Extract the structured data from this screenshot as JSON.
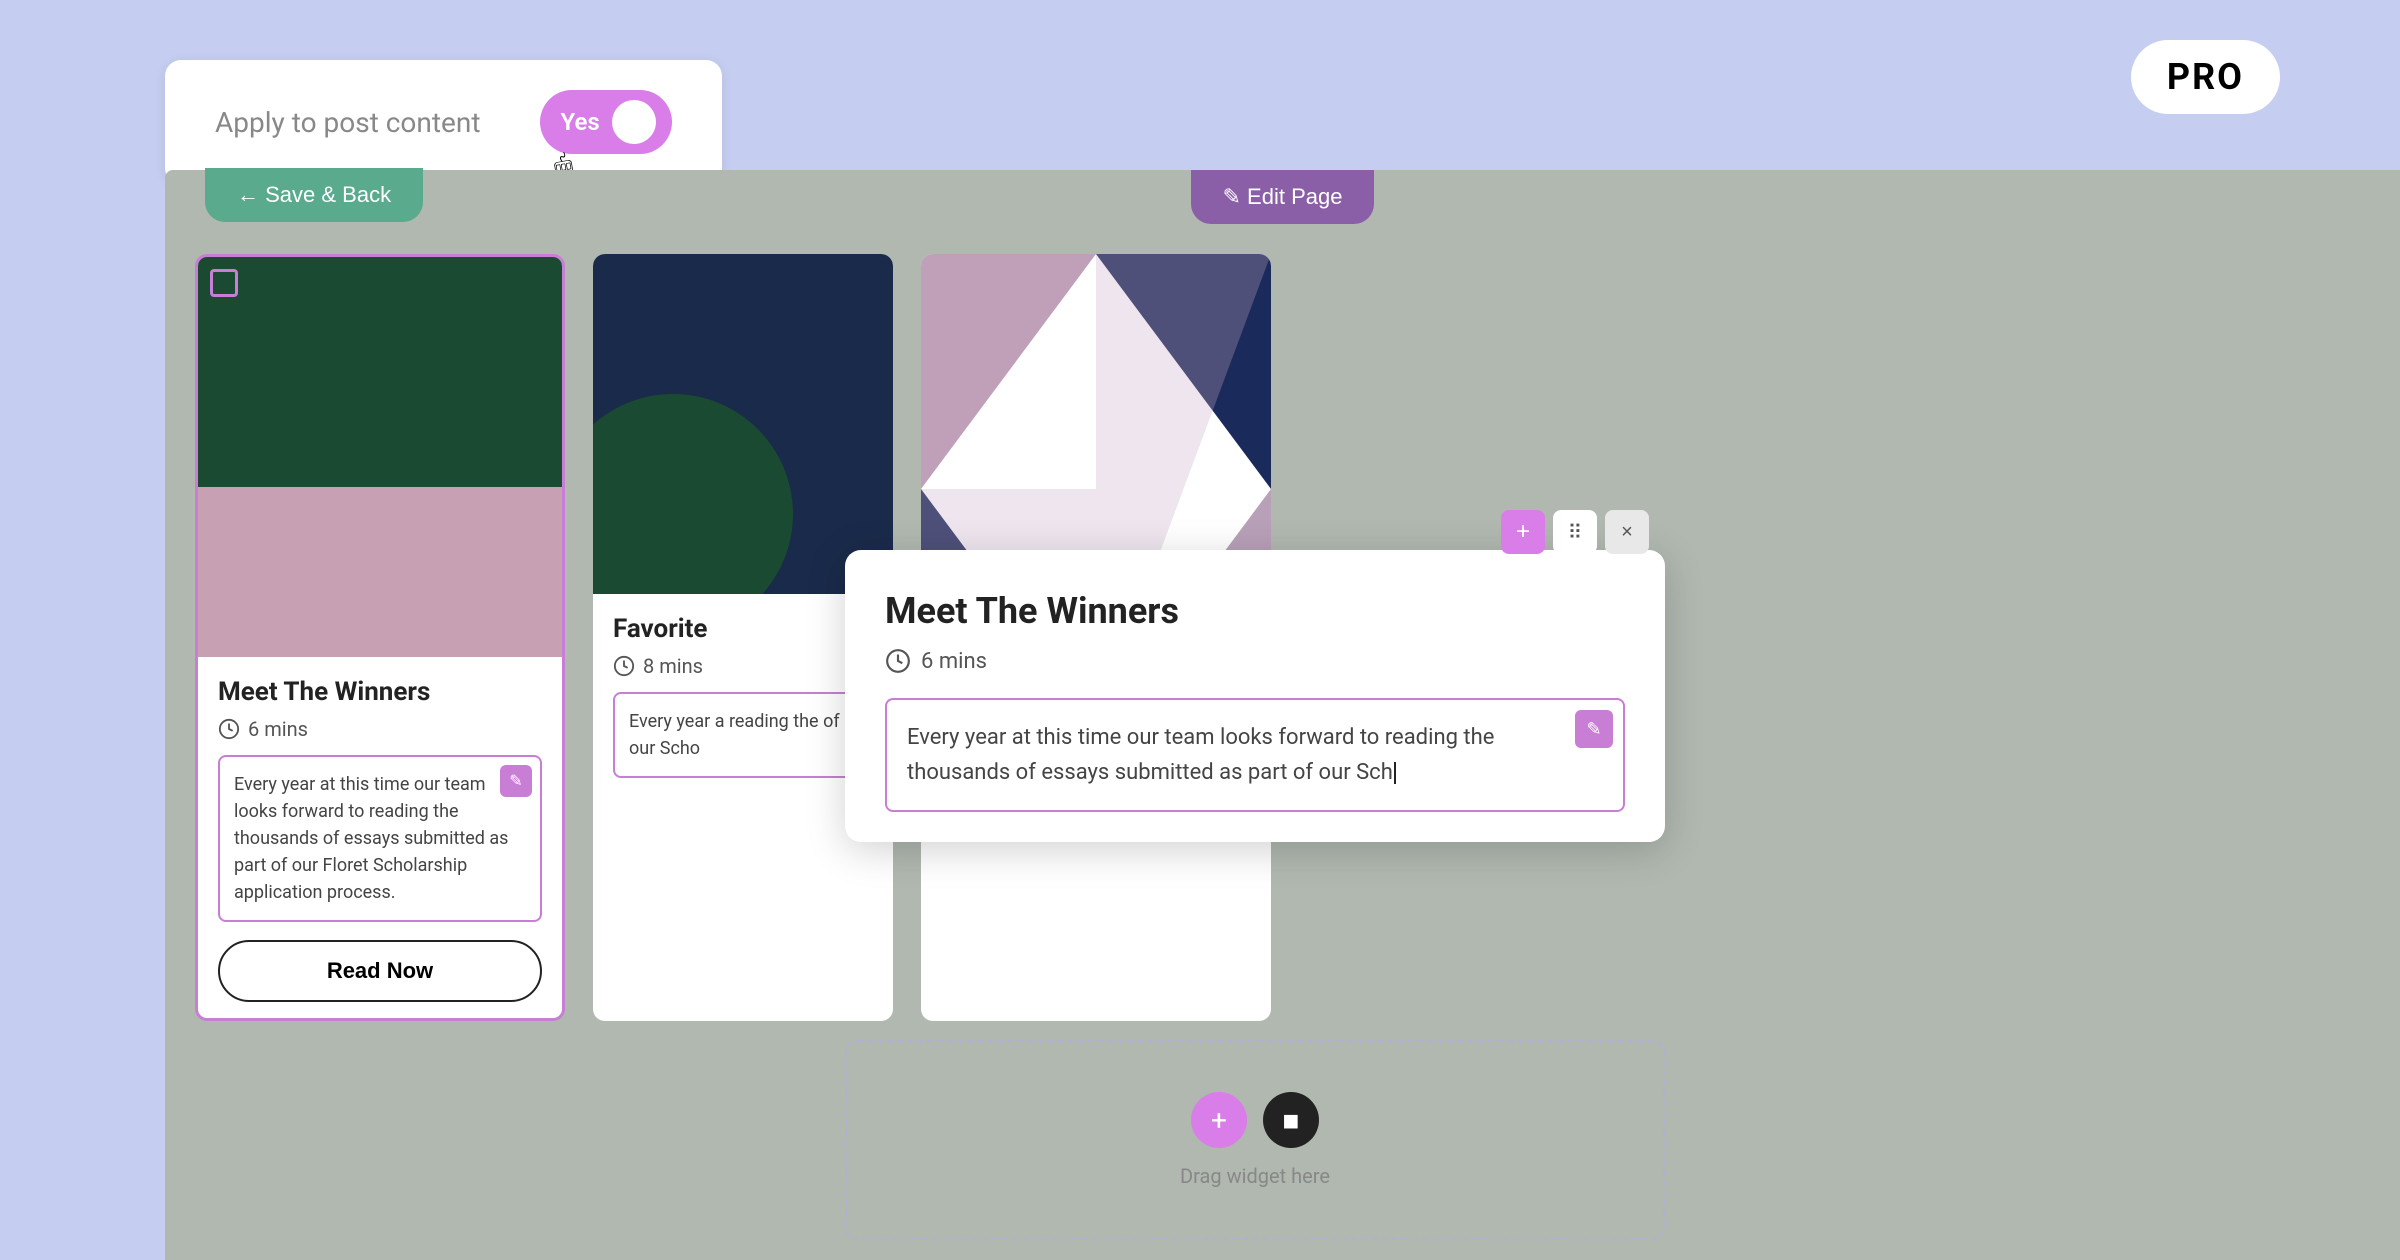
{
  "pro_badge": "PRO",
  "apply_panel": {
    "label": "Apply to post content",
    "toggle_label": "Yes"
  },
  "editor": {
    "save_back_label": "← Save & Back",
    "edit_page_label": "✎ Edit Page"
  },
  "card1": {
    "title": "Meet The Winners",
    "read_time": "6 mins",
    "excerpt": "Every year at this time our team looks forward to reading the thousands of essays submitted as part of our Floret Scholarship application process.",
    "button_label": "Read Now"
  },
  "card2": {
    "title": "Favorite",
    "read_time": "8 mins",
    "excerpt": "Every year a reading the of our Scho"
  },
  "floating_panel": {
    "title": "Meet The Winners",
    "read_time": "6 mins",
    "excerpt": "Every year at this time our team looks forward to reading the thousands of essays submitted as part of our Sch",
    "cursor": "|"
  },
  "drop_zone": {
    "label": "Drag widget here"
  },
  "toolbar": {
    "add": "+",
    "drag": "⠿",
    "close": "×"
  }
}
